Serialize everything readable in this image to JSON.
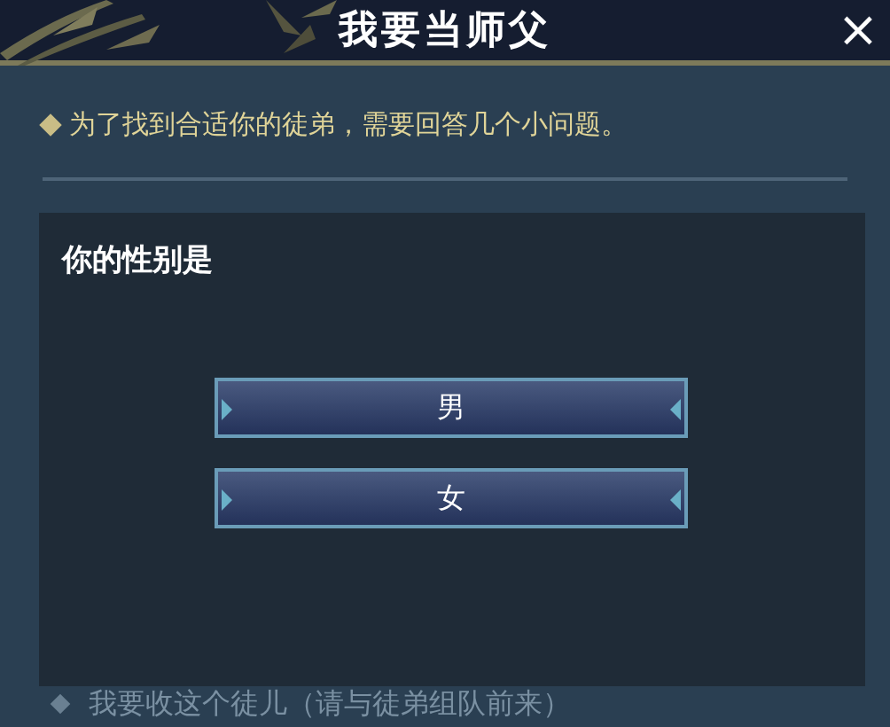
{
  "window": {
    "title": "我要当师父",
    "close": "×"
  },
  "intro": "为了找到合适你的徒弟，需要回答几个小问题。",
  "menu_items": [
    {
      "label": "我要收这个徒儿（请与徒弟组队前来）"
    }
  ],
  "dialog": {
    "question": "你的性别是",
    "options": [
      {
        "label": "男"
      },
      {
        "label": "女"
      }
    ]
  }
}
